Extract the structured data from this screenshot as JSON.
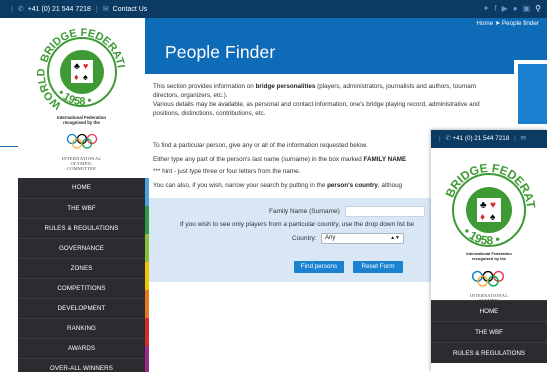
{
  "topbar": {
    "phone": "+41 (0) 21 544 7218",
    "contact": "Contact Us",
    "social_icons": [
      "twitter-icon",
      "facebook-icon",
      "youtube-icon",
      "flickr-icon",
      "instagram-icon",
      "search-icon"
    ]
  },
  "logo": {
    "arc_top": "BRIDGE FEDERATION",
    "arc_left": "WORLD",
    "arc_bottom": "• 1958 •",
    "suits": [
      "♣",
      "♥",
      "♦",
      "♠"
    ]
  },
  "federation_text": {
    "line1": "International Federation",
    "line2": "recognised by the"
  },
  "ioc": {
    "line1": "INTERNATIONAL",
    "line2": "OLYMPIC",
    "line3": "COMMITTEE"
  },
  "nav": [
    "HOME",
    "THE WBF",
    "RULES & REGULATIONS",
    "GOVERNANCE",
    "ZONES",
    "COMPETITIONS",
    "DEVELOPMENT",
    "RANKING",
    "AWARDS",
    "OVER-ALL WINNERS"
  ],
  "header": {
    "title": "People Finder",
    "breadcrumb_home": "Home",
    "breadcrumb_current": "People finder"
  },
  "content": {
    "p1_a": "This section provides information on ",
    "p1_b": "bridge personalities",
    "p1_c": " (players, administrators, journalists and authors, tournam",
    "p2": "directors, organizers, etc.).",
    "p3": "Various details may be available, as personal and contact information, one's bridge playing record, administrative and",
    "p4": "positions, distinctions, contributions, etc.",
    "p5": "To find a particular person, give any or all of the information requested below.",
    "p6_a": "Either type any part of the person's last name (surname) in the box marked ",
    "p6_b": "FAMILY NAME",
    "p7": "*** hint - just type three or four letters from the name.",
    "p8_a": "You can also, if you wish, narrow your search by putting in the ",
    "p8_b": "person's country",
    "p8_c": ", althoug"
  },
  "form": {
    "family_label": "Family Name (Surname)",
    "family_value": "",
    "country_hint": "If you wish to see only players from a particular country, use the drop down list be",
    "country_label": "Country:",
    "country_value": "Any",
    "find_button": "Find persons",
    "reset_button": "Reset Form"
  },
  "colors": {
    "topbar": "#0b3a63",
    "header": "#0d6bb7",
    "nav_bg": "#2a2c2f",
    "form_bg": "#d8e6f5",
    "button": "#1b82d0",
    "logo_green": "#3d9a35",
    "stripe": [
      "#4aa3df",
      "#2e9a44",
      "#8bbf3a",
      "#f2c300",
      "#e87722",
      "#d52b2b",
      "#9b2a8a"
    ]
  },
  "overlay": {
    "phone": "+41 (0) 21 544 7218",
    "nav": [
      "HOME",
      "THE WBF",
      "RULES & REGULATIONS"
    ]
  }
}
